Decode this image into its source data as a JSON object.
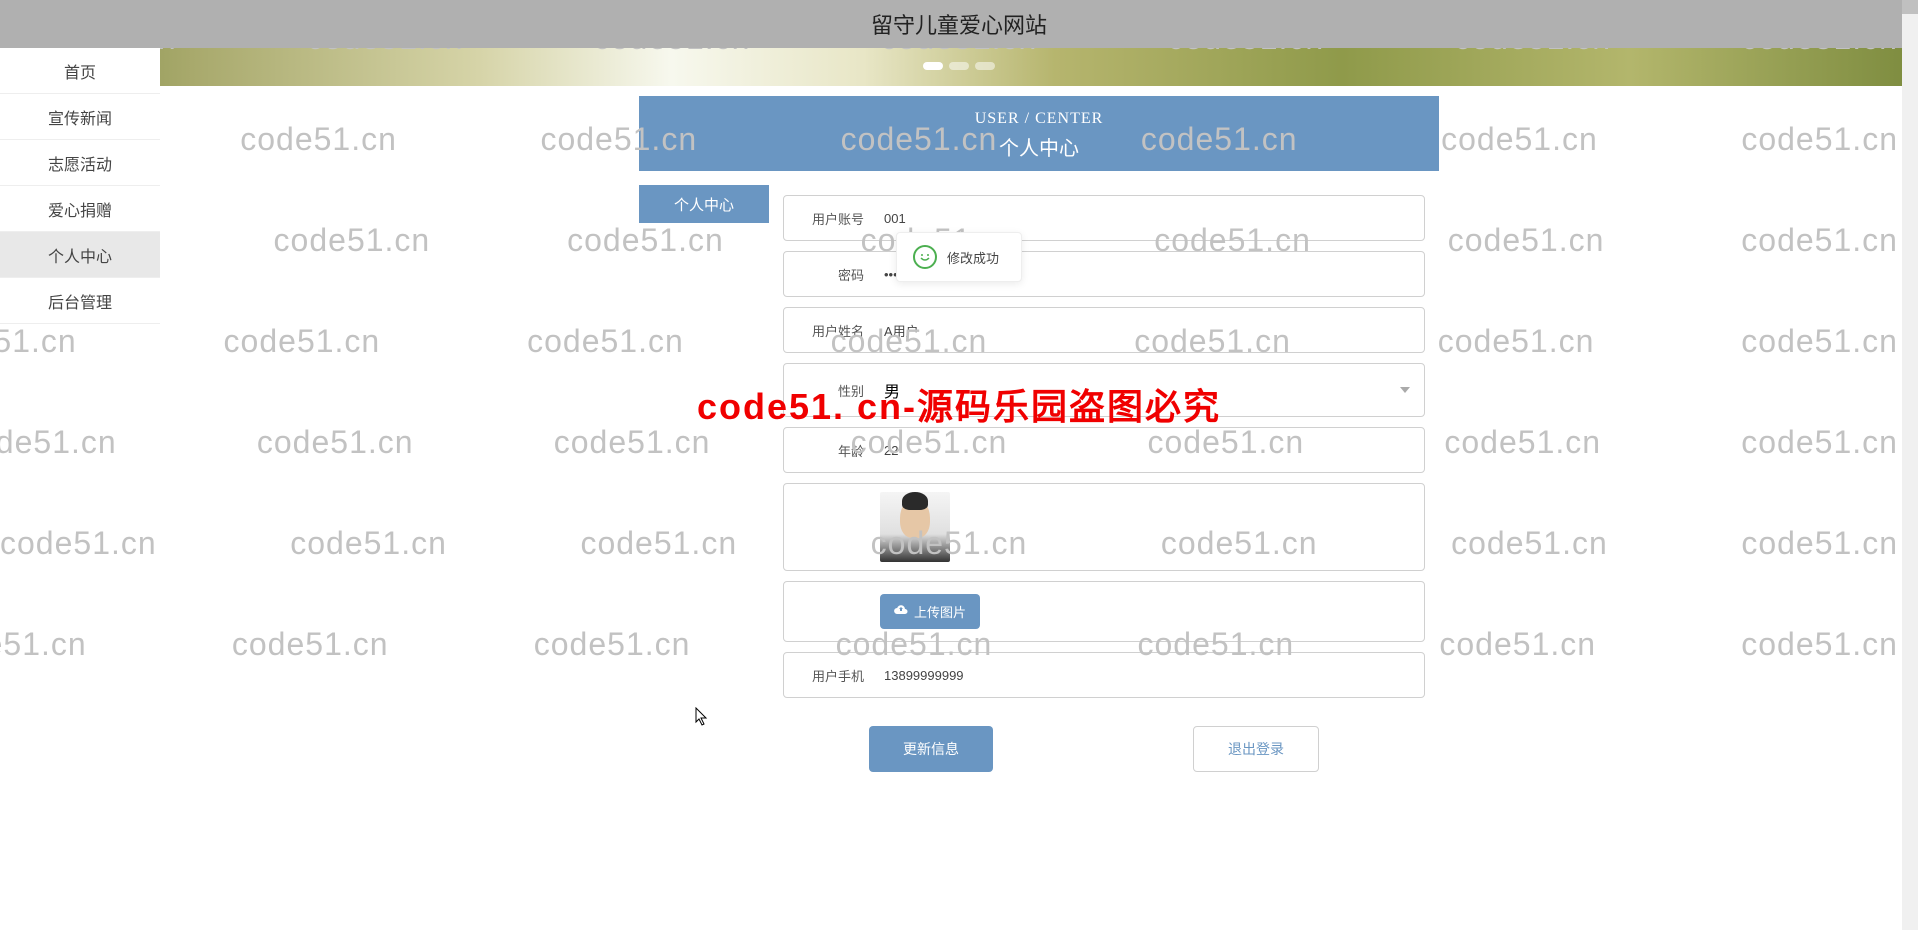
{
  "topbar": {
    "title": "留守儿童爱心网站"
  },
  "sidebar": {
    "items": [
      {
        "label": "首页"
      },
      {
        "label": "宣传新闻"
      },
      {
        "label": "志愿活动"
      },
      {
        "label": "爱心捐赠"
      },
      {
        "label": "个人中心"
      },
      {
        "label": "后台管理"
      }
    ],
    "active_index": 4
  },
  "center_header": {
    "en": "USER / CENTER",
    "cn": "个人中心"
  },
  "sub_sidebar": {
    "item": "个人中心"
  },
  "form": {
    "account": {
      "label": "用户账号",
      "value": "001"
    },
    "password": {
      "label": "密码",
      "value": "•••"
    },
    "username": {
      "label": "用户姓名",
      "value": "A用户"
    },
    "gender": {
      "label": "性别",
      "value": "男"
    },
    "age": {
      "label": "年龄",
      "value": "22"
    },
    "phone": {
      "label": "用户手机",
      "value": "13899999999"
    },
    "upload_btn": "上传图片"
  },
  "actions": {
    "update": "更新信息",
    "logout": "退出登录"
  },
  "toast": {
    "text": "修改成功"
  },
  "watermark": {
    "text": "code51.cn"
  },
  "overlay": {
    "text": "code51. cn-源码乐园盗图必究"
  }
}
